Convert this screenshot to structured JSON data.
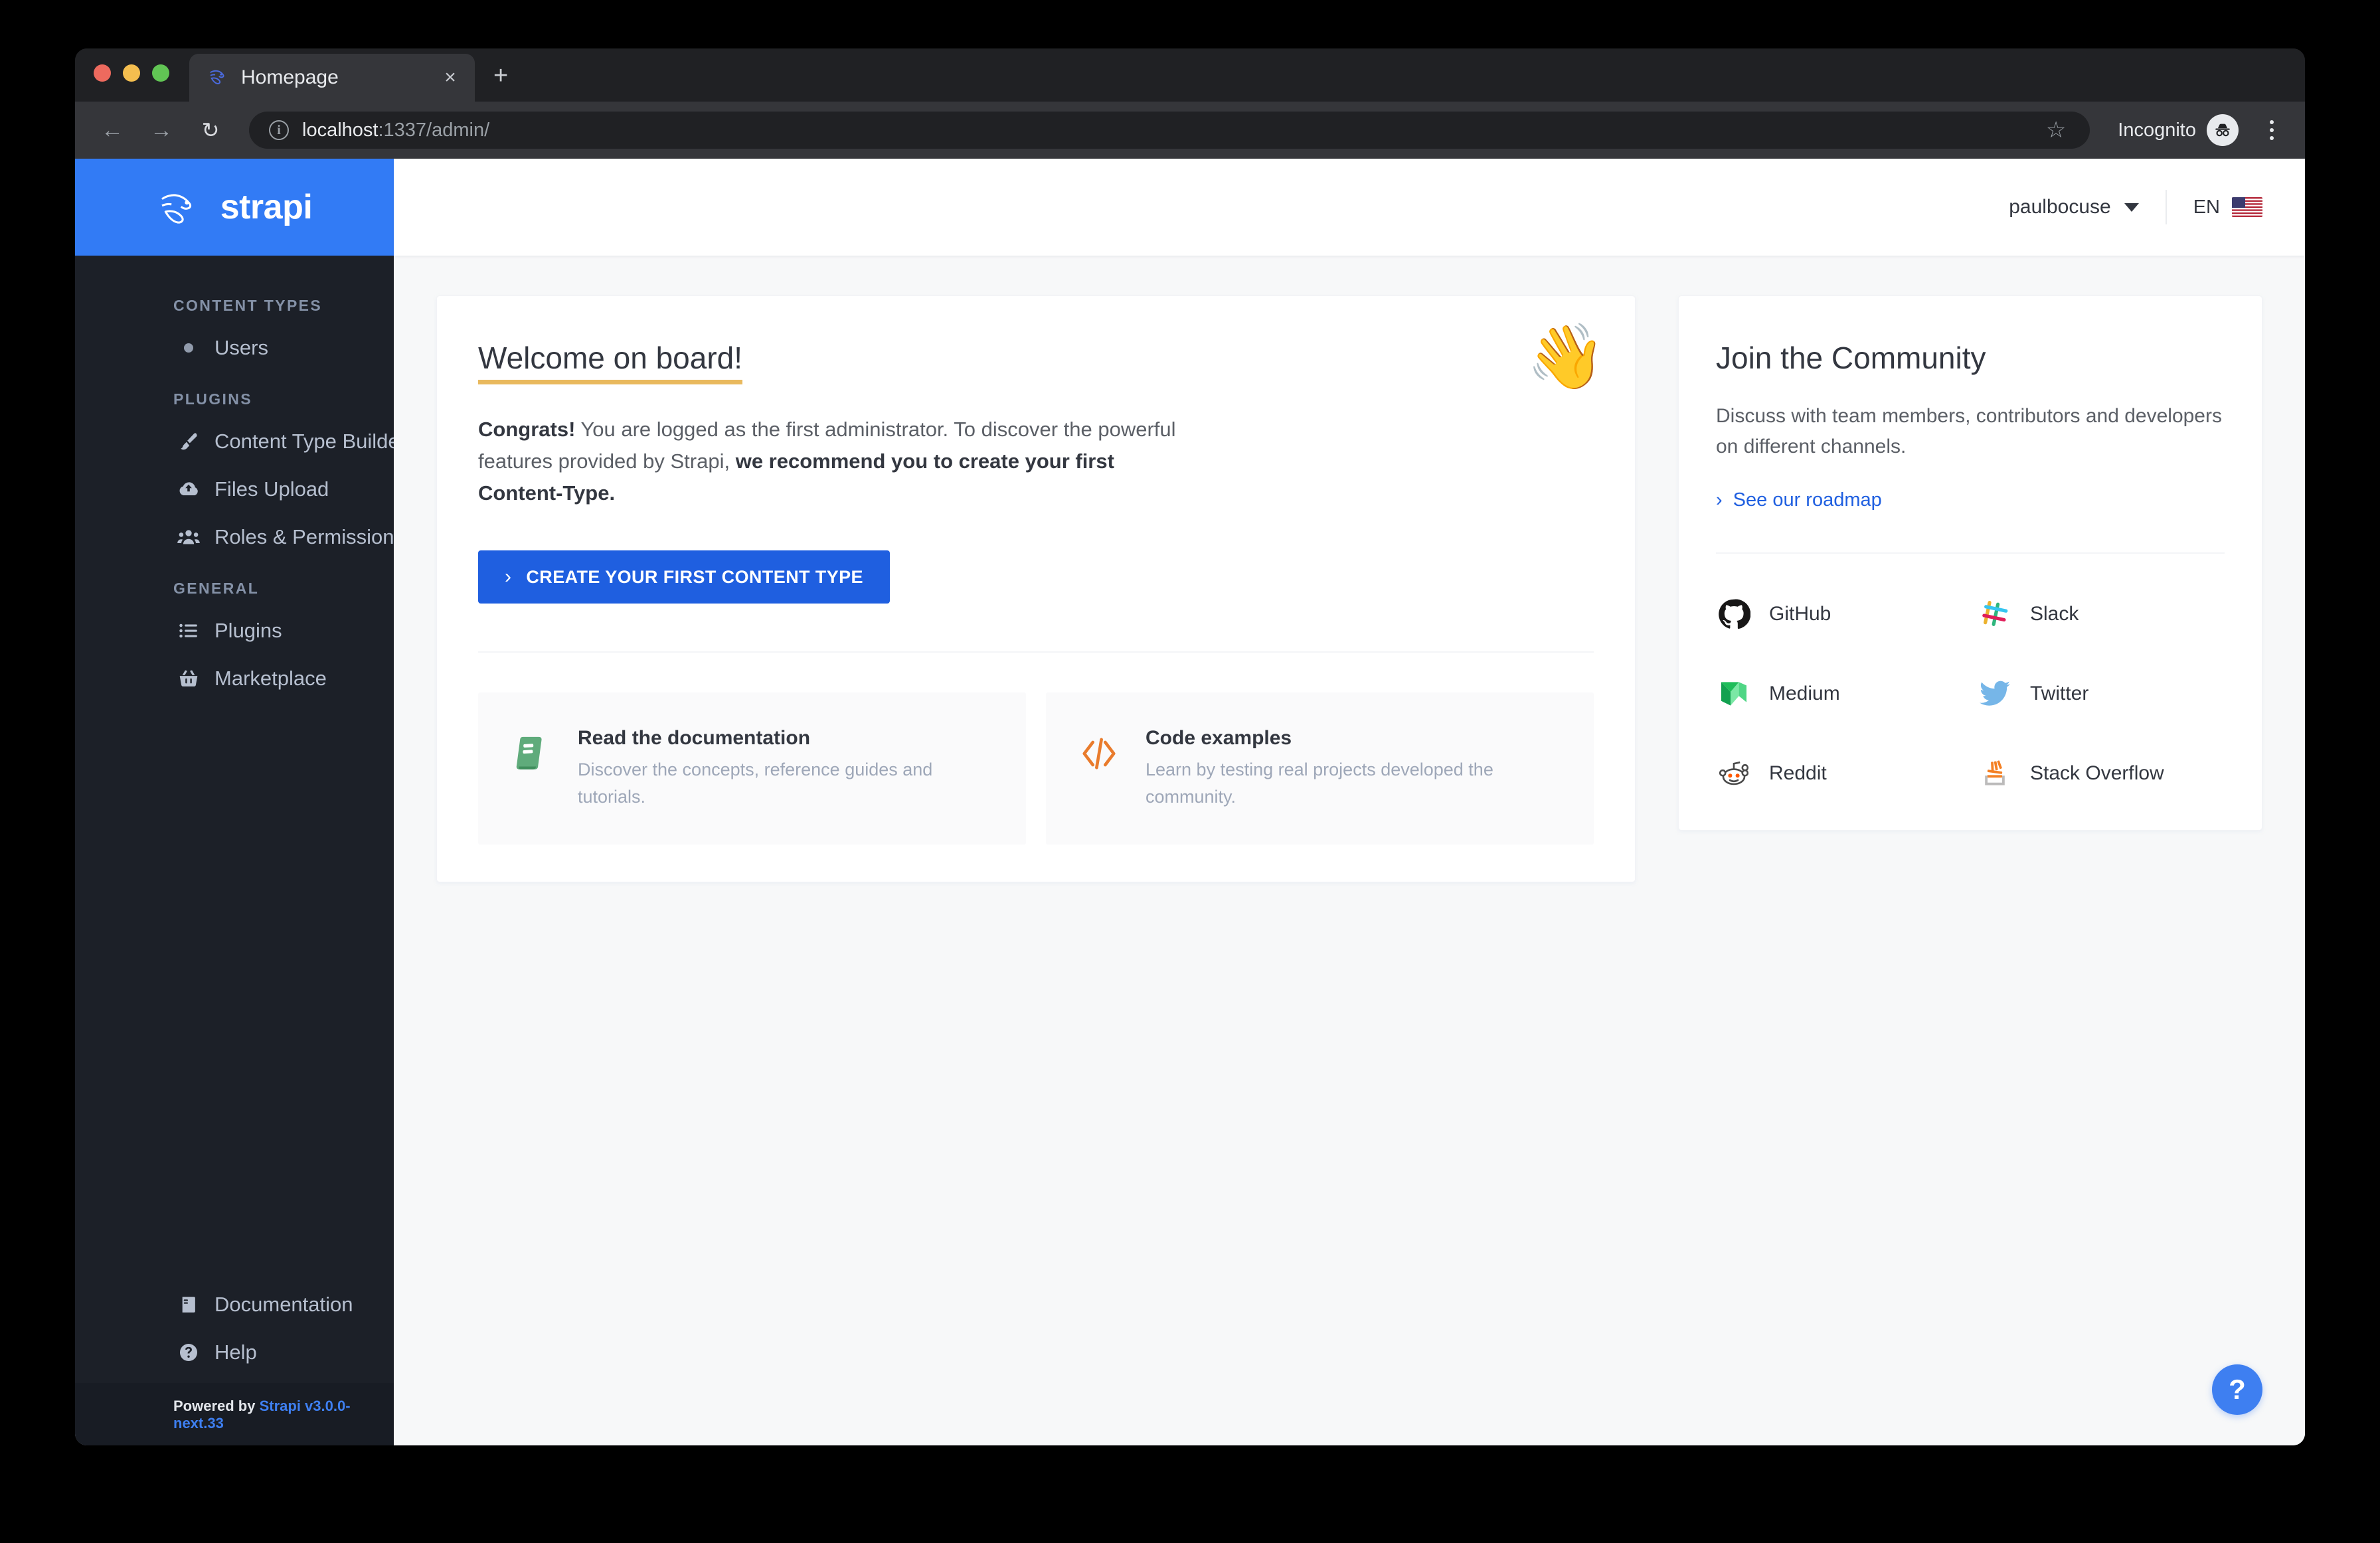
{
  "browser": {
    "tab": {
      "title": "Homepage",
      "favicon": "strapi-favicon",
      "close": "×"
    },
    "new_tab": "+",
    "back": "←",
    "forward": "→",
    "reload": "↻",
    "url_host": "localhost",
    "url_path": ":1337/admin/",
    "star": "☆",
    "incognito_label": "Incognito",
    "menu": "⋮"
  },
  "sidebar": {
    "logo_text": "strapi",
    "sections": [
      {
        "title": "CONTENT TYPES",
        "items": [
          {
            "label": "Users",
            "icon": "bullet-icon"
          }
        ]
      },
      {
        "title": "PLUGINS",
        "items": [
          {
            "label": "Content Type Builder",
            "icon": "paintbrush-icon"
          },
          {
            "label": "Files Upload",
            "icon": "cloud-upload-icon"
          },
          {
            "label": "Roles & Permissions",
            "icon": "users-group-icon"
          }
        ]
      },
      {
        "title": "GENERAL",
        "items": [
          {
            "label": "Plugins",
            "icon": "list-icon"
          },
          {
            "label": "Marketplace",
            "icon": "shopping-basket-icon"
          }
        ]
      }
    ],
    "bottom_items": [
      {
        "label": "Documentation",
        "icon": "book-icon"
      },
      {
        "label": "Help",
        "icon": "question-circle-icon"
      }
    ],
    "footer_prefix": "Powered by ",
    "footer_link": "Strapi v3.0.0-next.33"
  },
  "topbar": {
    "username": "paulbocuse",
    "language": "EN",
    "flag": "us-flag"
  },
  "welcome": {
    "title": "Welcome on board!",
    "text_normal_1": "Congrats!",
    "text_normal_2": " You are logged as the first administrator. To discover the powerful features provided by Strapi, ",
    "text_bold": " we recommend you to create your first Content-Type.",
    "wave_emoji": "👋",
    "cta_label": "CREATE YOUR FIRST CONTENT TYPE",
    "cta_chevron": "›",
    "tiles": [
      {
        "title": "Read the documentation",
        "desc": "Discover the concepts, reference guides and tutorials.",
        "icon": "green-book-icon"
      },
      {
        "title": "Code examples",
        "desc": "Learn by testing real projects developed the community.",
        "icon": "code-brackets-icon"
      }
    ]
  },
  "community": {
    "title": "Join the Community",
    "desc": "Discuss with team members, contributors and developers on different channels.",
    "roadmap_label": "See our roadmap",
    "roadmap_chevron": "›",
    "links": [
      {
        "label": "GitHub",
        "icon": "github-icon"
      },
      {
        "label": "Slack",
        "icon": "slack-icon"
      },
      {
        "label": "Medium",
        "icon": "medium-icon"
      },
      {
        "label": "Twitter",
        "icon": "twitter-icon"
      },
      {
        "label": "Reddit",
        "icon": "reddit-icon"
      },
      {
        "label": "Stack Overflow",
        "icon": "stackoverflow-icon"
      }
    ]
  },
  "help_fab": {
    "label": "?"
  },
  "colors": {
    "brand_blue": "#327BF5",
    "cta_blue": "#1F5FE0",
    "sidebar_bg": "#1C2028",
    "underline_gold": "#E9B95E",
    "content_bg": "#F7F8F9"
  }
}
